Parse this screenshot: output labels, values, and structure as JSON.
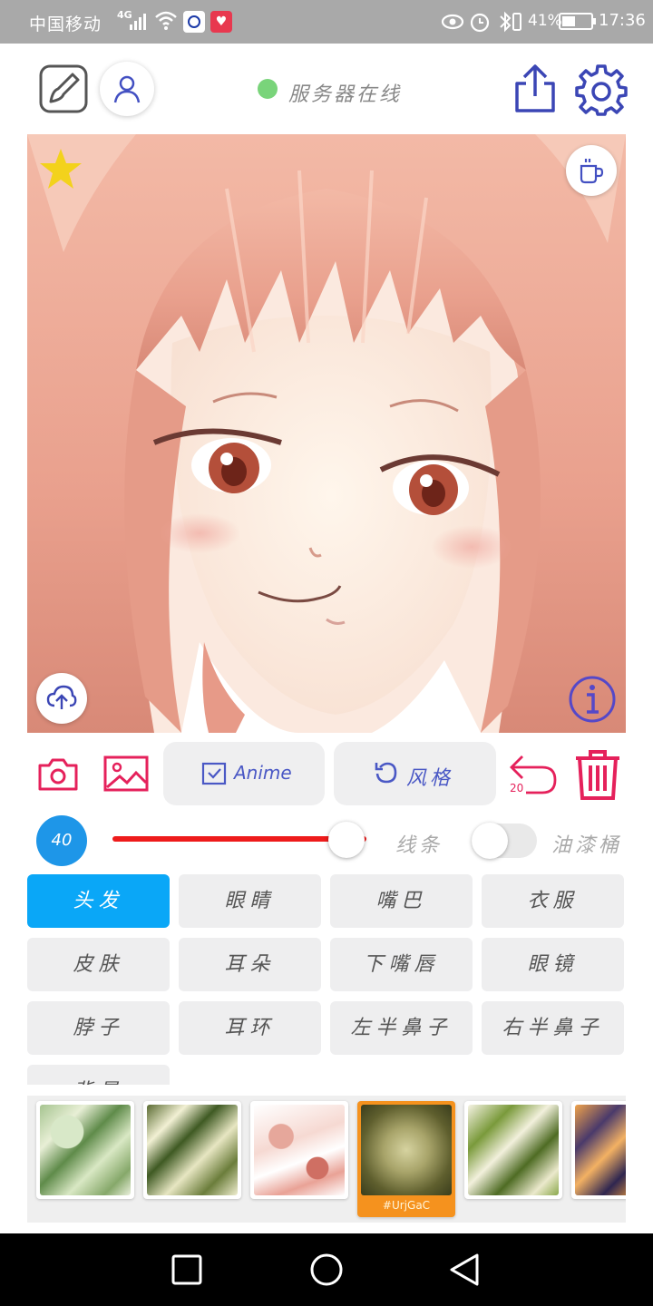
{
  "status_bar": {
    "carrier": "中国移动",
    "network": "4G",
    "battery": "41%",
    "time": "17:36"
  },
  "header": {
    "server_status": "服务器在线",
    "server_status_color": "#79d47a"
  },
  "canvas": {
    "favorite_color": "#f3d21c"
  },
  "tools": {
    "anime_label": "Anime",
    "style_label": "风格",
    "undo_count": "20"
  },
  "brush": {
    "size": "40",
    "slider_level": 0.72,
    "line_label": "线条",
    "bucket_label": "油漆桶",
    "bucket_enabled": false,
    "accent_color": "#ee1b1b"
  },
  "parts": [
    {
      "label": "头发",
      "active": true
    },
    {
      "label": "眼睛",
      "active": false
    },
    {
      "label": "嘴巴",
      "active": false
    },
    {
      "label": "衣服",
      "active": false
    },
    {
      "label": "皮肤",
      "active": false
    },
    {
      "label": "耳朵",
      "active": false
    },
    {
      "label": "下嘴唇",
      "active": false
    },
    {
      "label": "眼镜",
      "active": false
    },
    {
      "label": "脖子",
      "active": false
    },
    {
      "label": "耳环",
      "active": false
    },
    {
      "label": "左半鼻子",
      "active": false
    },
    {
      "label": "右半鼻子",
      "active": false
    },
    {
      "label": "背景",
      "active": false
    }
  ],
  "textures": {
    "selected_name": "#UrjGaC"
  },
  "icons": [
    "brush-icon",
    "user-icon",
    "share-icon",
    "gear-icon",
    "star-icon",
    "coffee-cup-icon",
    "cloud-upload-icon",
    "info-icon",
    "camera-icon",
    "image-icon",
    "checkbox-icon",
    "refresh-icon",
    "undo-icon",
    "trash-icon",
    "back-icon",
    "home-icon",
    "recents-icon"
  ]
}
